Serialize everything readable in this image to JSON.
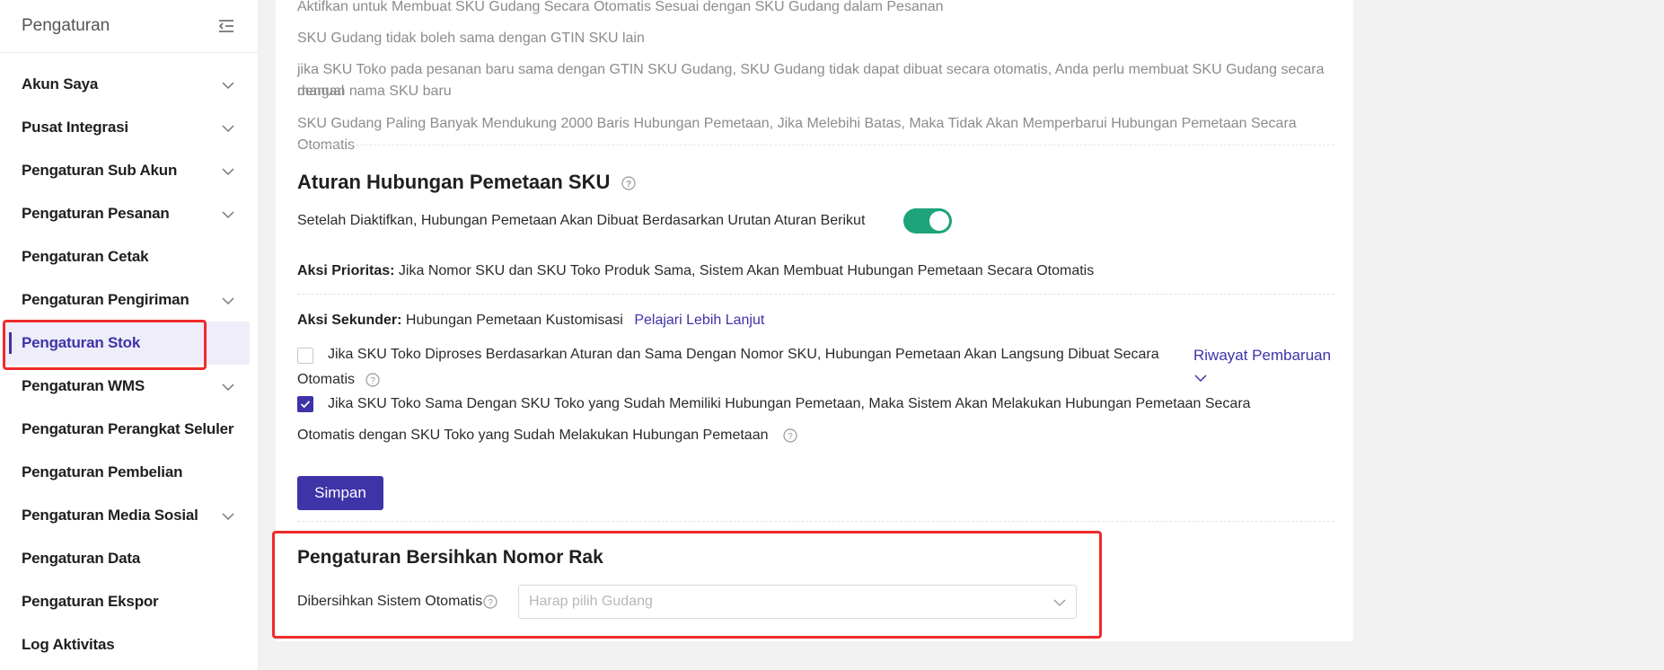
{
  "sidebar": {
    "title": "Pengaturan",
    "items": [
      {
        "label": "Akun Saya",
        "expandable": true
      },
      {
        "label": "Pusat Integrasi",
        "expandable": true
      },
      {
        "label": "Pengaturan Sub Akun",
        "expandable": true
      },
      {
        "label": "Pengaturan Pesanan",
        "expandable": true
      },
      {
        "label": "Pengaturan Cetak",
        "expandable": false
      },
      {
        "label": "Pengaturan Pengiriman",
        "expandable": true
      },
      {
        "label": "Pengaturan Stok",
        "expandable": false,
        "active": true
      },
      {
        "label": "Pengaturan WMS",
        "expandable": true
      },
      {
        "label": "Pengaturan Perangkat Seluler",
        "expandable": false
      },
      {
        "label": "Pengaturan Pembelian",
        "expandable": false
      },
      {
        "label": "Pengaturan Media Sosial",
        "expandable": true
      },
      {
        "label": "Pengaturan Data",
        "expandable": false
      },
      {
        "label": "Pengaturan Ekspor",
        "expandable": false
      },
      {
        "label": "Log Aktivitas",
        "expandable": false
      }
    ]
  },
  "notes": {
    "line1": "Aktifkan untuk Membuat SKU Gudang Secara Otomatis Sesuai dengan SKU Gudang dalam Pesanan",
    "line2": "SKU Gudang tidak boleh sama dengan GTIN SKU lain",
    "line3a": "jika SKU Toko pada pesanan baru sama dengan GTIN SKU Gudang, SKU Gudang tidak dapat dibuat secara otomatis, Anda perlu membuat SKU Gudang secara manual",
    "line3b": "dengan nama SKU baru",
    "line4": "SKU Gudang Paling Banyak Mendukung 2000 Baris Hubungan Pemetaan, Jika Melebihi Batas, Maka Tidak Akan Memperbarui Hubungan Pemetaan Secara Otomatis"
  },
  "mapping": {
    "title": "Aturan Hubungan Pemetaan SKU",
    "toggle_text": "Setelah Diaktifkan, Hubungan Pemetaan Akan Dibuat Berdasarkan Urutan Aturan Berikut",
    "toggle_on": true,
    "priority_label": "Aksi Prioritas:",
    "priority_text": " Jika Nomor SKU dan SKU Toko Produk Sama, Sistem Akan Membuat Hubungan Pemetaan Secara Otomatis",
    "secondary_label": "Aksi Sekunder:",
    "secondary_text": " Hubungan Pemetaan Kustomisasi",
    "learn_more": "Pelajari Lebih Lanjut",
    "option1_a": "Jika SKU Toko Diproses Berdasarkan Aturan dan Sama Dengan Nomor SKU, Hubungan Pemetaan Akan Langsung Dibuat Secara",
    "option1_b": "Otomatis",
    "option1_checked": false,
    "option2_a": "Jika SKU Toko Sama Dengan SKU Toko yang Sudah Memiliki Hubungan Pemetaan, Maka Sistem Akan Melakukan Hubungan Pemetaan Secara",
    "option2_b": "Otomatis dengan SKU Toko yang Sudah Melakukan Hubungan Pemetaan",
    "option2_checked": true,
    "history_link": "Riwayat Pembaruan",
    "save": "Simpan"
  },
  "rack": {
    "title": "Pengaturan Bersihkan Nomor Rak",
    "label": "Dibersihkan Sistem Otomatis",
    "placeholder": "Harap pilih Gudang"
  },
  "colors": {
    "accent": "#3f33a8",
    "toggle": "#1ea37a",
    "highlight": "#ef2b2b"
  }
}
